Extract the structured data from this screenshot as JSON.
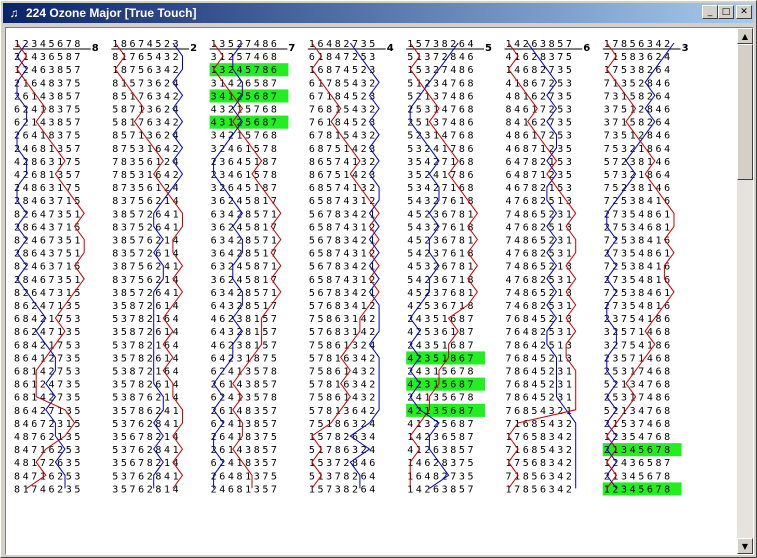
{
  "window": {
    "title": "224 Ozone Major [True Touch]",
    "minimize_label": "_",
    "maximize_label": "□",
    "close_label": "✕"
  },
  "colors": {
    "titlebar_start": "#0a246a",
    "red_line": "#cc0000",
    "blue_line": "#0000cc",
    "highlight": "#22ee22"
  },
  "icons": {
    "app": "bell-icon",
    "scroll_up": "arrow-up-icon",
    "scroll_down": "arrow-down-icon"
  },
  "columns": [
    {
      "lead_end": "8",
      "rows": [
        "12345678",
        "21436587",
        "12463857",
        "21648375",
        "26143857",
        "62418375",
        "62143857",
        "26418375",
        "24681357",
        "42863175",
        "42681357",
        "24863175",
        "28463715",
        "82647351",
        "28643715",
        "82467351",
        "28643751",
        "82463715",
        "28467351",
        "82647315",
        "86247135",
        "68421753",
        "86247135",
        "68421753",
        "86412735",
        "68142753",
        "86124735",
        "68142735",
        "86427135",
        "84672315",
        "48762135",
        "84716253",
        "48172635",
        "84716253",
        "81746235"
      ],
      "highlight": []
    },
    {
      "lead_end": "2",
      "rows": [
        "18674523",
        "81765432",
        "18756342",
        "81573624",
        "85176342",
        "58713624",
        "58176342",
        "85713624",
        "87531642",
        "78356124",
        "78531642",
        "87356124",
        "83756214",
        "38572641",
        "83752641",
        "38576214",
        "83572614",
        "38756241",
        "83756214",
        "38572641",
        "35872614",
        "53782164",
        "35872614",
        "53782164",
        "35782614",
        "53872164",
        "35782614",
        "53876214",
        "35786241",
        "53762841",
        "35678214",
        "53762841",
        "35678214",
        "53762841",
        "35762814"
      ],
      "highlight": []
    },
    {
      "lead_end": "7",
      "rows": [
        "13527486",
        "31257468",
        "13245786",
        "31426587",
        "34125687",
        "43215768",
        "43125687",
        "34215768",
        "32461578",
        "23645187",
        "23461578",
        "32645187",
        "36245817",
        "63428571",
        "36245817",
        "63428571",
        "36428517",
        "63245871",
        "36245817",
        "63428571",
        "64328517",
        "46238157",
        "64328157",
        "46238157",
        "64231875",
        "62413578",
        "26143857",
        "62413578",
        "26148357",
        "62413857",
        "26418375",
        "26143857",
        "62418357",
        "26481375",
        "24681357"
      ],
      "highlight": [
        2,
        4,
        6
      ]
    },
    {
      "lead_end": "4",
      "rows": [
        "16482735",
        "61847253",
        "16874523",
        "61785432",
        "67184523",
        "76815432",
        "76184523",
        "67815432",
        "68751423",
        "86574132",
        "86751423",
        "68574132",
        "65874312",
        "56783421",
        "65874312",
        "56783421",
        "65874312",
        "56783421",
        "65874312",
        "56783421",
        "57683412",
        "75863142",
        "57683142",
        "75861324",
        "57816342",
        "75861432",
        "57816342",
        "75861432",
        "57813642",
        "75186324",
        "15782634",
        "51786324",
        "15372846",
        "51378264",
        "15738264"
      ],
      "highlight": []
    },
    {
      "lead_end": "5",
      "rows": [
        "15738264",
        "51372846",
        "15327486",
        "51234768",
        "52137486",
        "25314768",
        "25137486",
        "52314768",
        "53241786",
        "35427168",
        "35241786",
        "53427168",
        "54327618",
        "45236781",
        "54327618",
        "45236781",
        "54237618",
        "45326781",
        "54236718",
        "45237681",
        "42536718",
        "24351687",
        "42536187",
        "24351687",
        "42351867",
        "24315678",
        "42315687",
        "24135678",
        "42135687",
        "41325687",
        "14236587",
        "41263857",
        "14628375",
        "16482735",
        "14263857"
      ],
      "highlight": [
        24,
        26,
        28
      ]
    },
    {
      "lead_end": "6",
      "rows": [
        "14263857",
        "41628375",
        "14682735",
        "41867253",
        "48162735",
        "84617253",
        "84162735",
        "48617253",
        "46871235",
        "64782153",
        "64871235",
        "46782153",
        "47682513",
        "74865231",
        "47682513",
        "74865231",
        "47682531",
        "74865213",
        "47682531",
        "74865213",
        "74682531",
        "76845213",
        "76482531",
        "78642513",
        "76845213",
        "78645231",
        "76845231",
        "78645231",
        "76854321",
        "71685432",
        "17658342",
        "71685432",
        "17568342",
        "71856342",
        "17856342"
      ],
      "highlight": []
    },
    {
      "lead_end": "3",
      "rows": [
        "17856342",
        "71583624",
        "17538264",
        "71352846",
        "73158264",
        "37512846",
        "37158264",
        "73512846",
        "75321864",
        "57238146",
        "57321864",
        "75238146",
        "72538416",
        "27354861",
        "27534681",
        "72538416",
        "27354861",
        "72538416",
        "27354816",
        "72538461",
        "27354816",
        "23754186",
        "32571468",
        "32754186",
        "23571468",
        "25317468",
        "52134768",
        "25317486",
        "52134768",
        "21537468",
        "12354768",
        "21345678",
        "12436587",
        "21345678",
        "12345678"
      ],
      "highlight": [
        31,
        34
      ]
    }
  ]
}
